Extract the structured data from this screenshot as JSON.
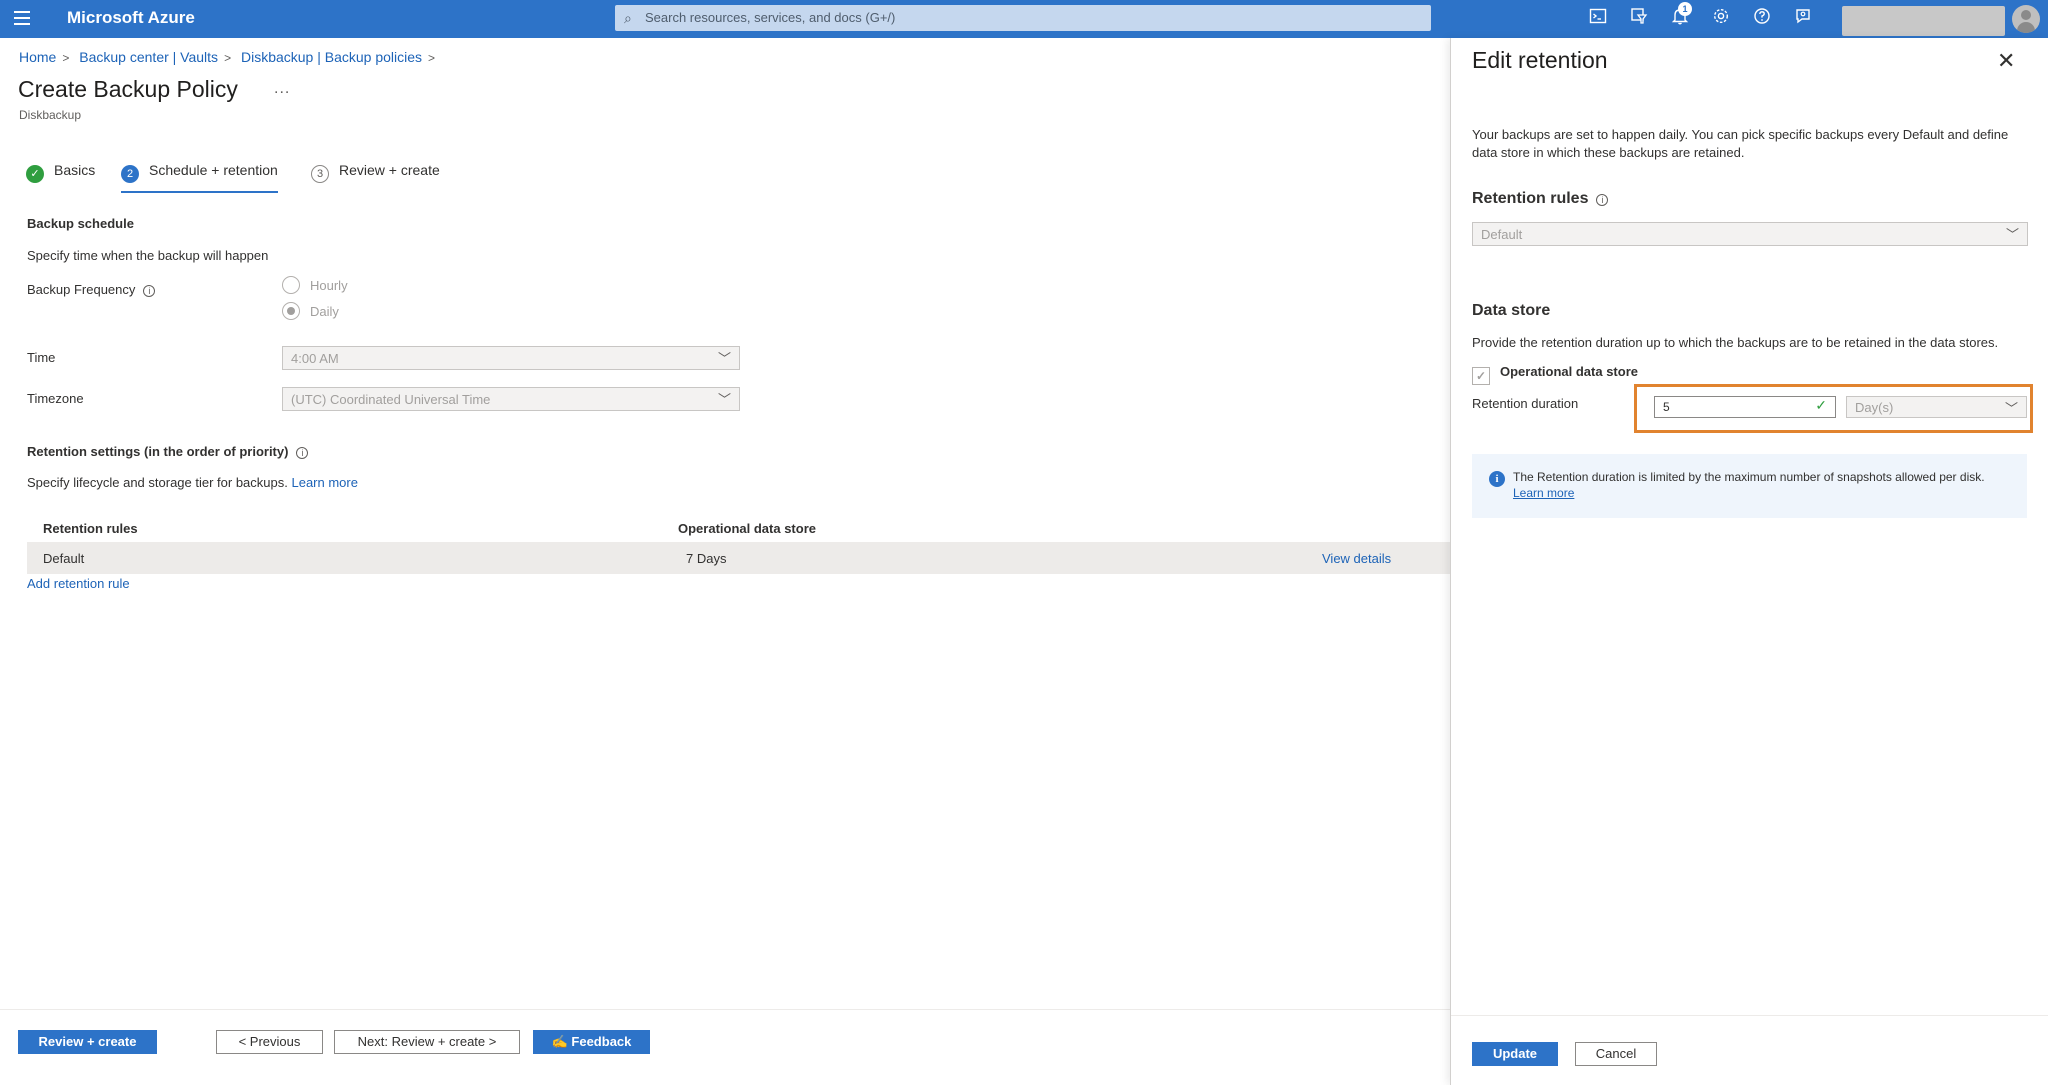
{
  "topbar": {
    "brand": "Microsoft Azure",
    "search_placeholder": "Search resources, services, and docs (G+/)",
    "notification_count": "1",
    "icons": [
      "cloud-shell-icon",
      "directory-filter-icon",
      "bell-icon",
      "gear-icon",
      "help-icon",
      "feedback-icon"
    ]
  },
  "breadcrumb": [
    "Home",
    "Backup center | Vaults",
    "Diskbackup | Backup policies"
  ],
  "page": {
    "title": "Create Backup Policy",
    "subtitle": "Diskbackup",
    "more": "..."
  },
  "tabs": [
    {
      "num": "✓",
      "label": "Basics",
      "state": "done"
    },
    {
      "num": "2",
      "label": "Schedule + retention",
      "state": "current"
    },
    {
      "num": "3",
      "label": "Review + create",
      "state": "todo"
    }
  ],
  "schedule": {
    "heading": "Backup schedule",
    "desc": "Specify time when the backup will happen",
    "frequency_label": "Backup Frequency",
    "frequency_options": [
      "Hourly",
      "Daily"
    ],
    "frequency_selected": "Daily",
    "time_label": "Time",
    "time_value": "4:00 AM",
    "tz_label": "Timezone",
    "tz_value": "(UTC) Coordinated Universal Time"
  },
  "retention": {
    "heading": "Retention settings (in the order of priority)",
    "desc": "Specify lifecycle and storage tier for backups.",
    "learn_more": "Learn more",
    "columns": [
      "Retention rules",
      "Operational data store"
    ],
    "rows": [
      {
        "rule": "Default",
        "store": "7 Days",
        "action": "View details"
      }
    ],
    "add_rule": "Add retention rule"
  },
  "footer": {
    "review_create": "Review + create",
    "previous": "< Previous",
    "next": "Next: Review + create >",
    "feedback": "Feedback"
  },
  "panel": {
    "title": "Edit retention",
    "desc": "Your backups are set to happen daily. You can pick specific backups every Default and define data store in which these backups are retained.",
    "rules_label": "Retention rules",
    "rules_value": "Default",
    "datastore_heading": "Data store",
    "datastore_desc": "Provide the retention duration up to which the backups are to be retained in the data stores.",
    "operational_label": "Operational data store",
    "duration_label": "Retention duration",
    "duration_value": "5",
    "duration_unit": "Day(s)",
    "info_text": "The Retention duration is limited by the maximum number of snapshots allowed per disk.",
    "info_link": "Learn more",
    "update": "Update",
    "cancel": "Cancel"
  },
  "colors": {
    "accent": "#2d73c8",
    "success": "#2f9e3f",
    "highlight": "#e1832f"
  }
}
